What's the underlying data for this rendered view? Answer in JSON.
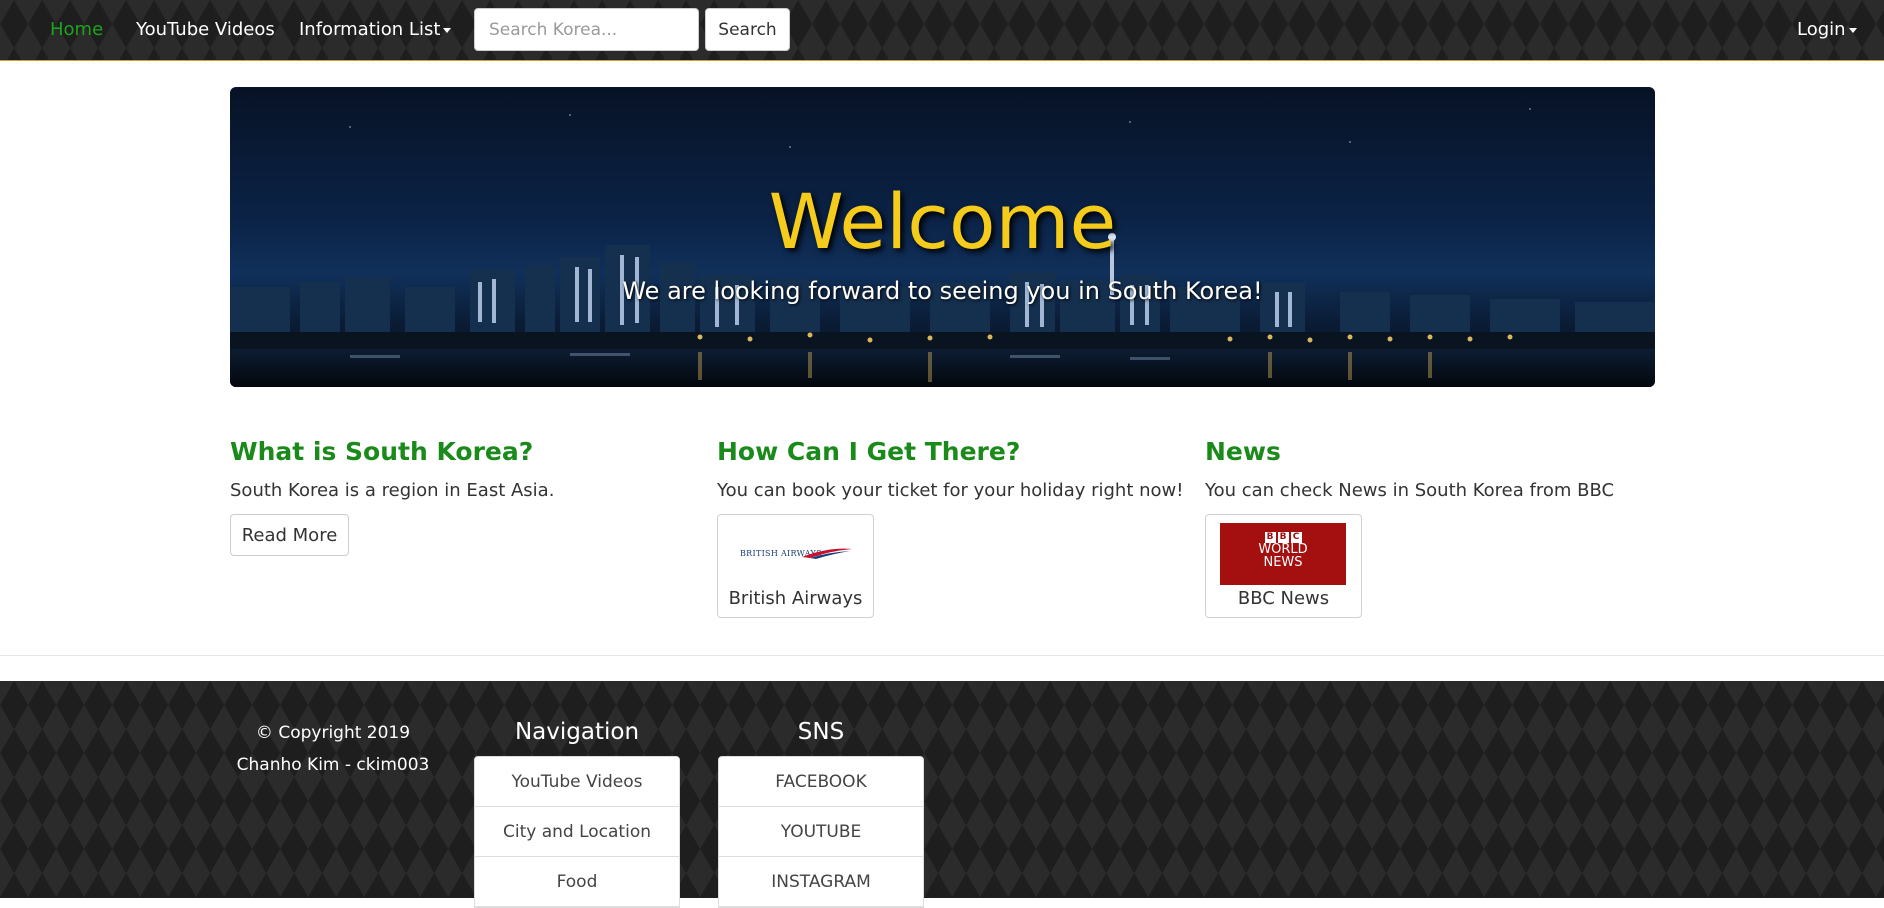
{
  "navbar": {
    "links": [
      {
        "label": "Home",
        "active": true
      },
      {
        "label": "YouTube Videos"
      },
      {
        "label": "Information List"
      }
    ],
    "search": {
      "placeholder": "Search Korea...",
      "button_label": "Search"
    },
    "login_label": "Login",
    "border_color": "#c9a227"
  },
  "hero": {
    "title": "Welcome",
    "subtitle": "We are looking forward to seeing you in South Korea!",
    "title_color": "#f5cc1b"
  },
  "columns": [
    {
      "heading": "What is South Korea?",
      "text": "South Korea is a region in East Asia.",
      "button_label": "Read More"
    },
    {
      "heading": "How Can I Get There?",
      "text": "You can book your ticket for your holiday right now!",
      "card": {
        "logo_text": "BRITISH AIRWAYS",
        "caption": "British Airways"
      }
    },
    {
      "heading": "News",
      "text": "You can check News in South Korea from BBC",
      "card": {
        "logo_blocks": [
          "B",
          "B",
          "C"
        ],
        "logo_line1": "WORLD",
        "logo_line2": "NEWS",
        "caption": "BBC News"
      }
    }
  ],
  "footer": {
    "copyright_line1": "© Copyright 2019",
    "copyright_line2": "Chanho Kim - ckim003",
    "navigation": {
      "heading": "Navigation",
      "items": [
        "YouTube Videos",
        "City and Location",
        "Food"
      ]
    },
    "sns": {
      "heading": "SNS",
      "items": [
        "FACEBOOK",
        "YOUTUBE",
        "INSTAGRAM"
      ]
    }
  },
  "colors": {
    "heading_green": "#1a8a1a",
    "active_link_green": "#1fa31f",
    "bbc_red": "#a40f0f"
  }
}
